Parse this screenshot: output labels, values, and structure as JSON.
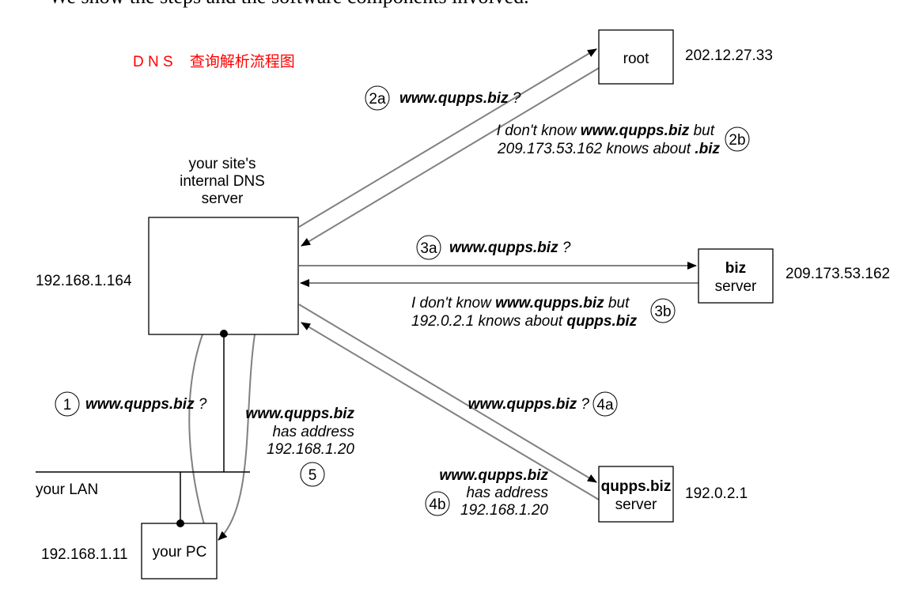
{
  "header_cut_text": "We show the steps and the software components involved.",
  "title": "D N S    查询解析流程图",
  "title_color": "#ff0000",
  "nodes": {
    "root": {
      "label": "root",
      "ip": "202.12.27.33"
    },
    "dns": {
      "label_lines": [
        "your site's",
        "internal DNS",
        "server"
      ],
      "ip": "192.168.1.164"
    },
    "biz": {
      "label_bold": "biz",
      "label": "server",
      "ip": "209.173.53.162"
    },
    "qupps": {
      "label_bold": "qupps.biz",
      "label": "server",
      "ip": "192.0.2.1"
    },
    "pc": {
      "label": "your PC",
      "ip": "192.168.1.11"
    },
    "lan": {
      "label": "your LAN"
    }
  },
  "steps": {
    "s1": {
      "num": "1",
      "query": "www.qupps.biz",
      "q": " ?"
    },
    "s2a": {
      "num": "2a",
      "query": "www.qupps.biz",
      "q": " ?"
    },
    "s2b": {
      "num": "2b",
      "l1a": "I don't know ",
      "l1b": "www.qupps.biz",
      "l1c": " but",
      "l2a": "209.173.53.162 knows about ",
      "l2b": ".biz"
    },
    "s3a": {
      "num": "3a",
      "query": "www.qupps.biz",
      "q": " ?"
    },
    "s3b": {
      "num": "3b",
      "l1a": "I don't know ",
      "l1b": "www.qupps.biz",
      "l1c": " but",
      "l2a": "192.0.2.1 knows about ",
      "l2b": "qupps.biz"
    },
    "s4a": {
      "num": "4a",
      "query": "www.qupps.biz",
      "q": " ?"
    },
    "s4b": {
      "num": "4b",
      "l1": "www.qupps.biz",
      "l2": "has address",
      "l3": "192.168.1.20"
    },
    "s5": {
      "num": "5",
      "l1": "www.qupps.biz",
      "l2": "has address",
      "l3": "192.168.1.20"
    }
  }
}
